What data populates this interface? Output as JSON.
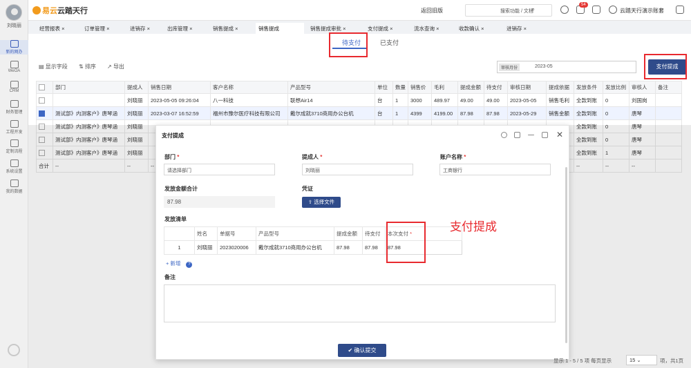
{
  "sidebar": {
    "user_name": "刘晓丽",
    "items": [
      {
        "label": "新的网办",
        "icon": "new-office-icon",
        "active": true
      },
      {
        "label": "WeOA",
        "icon": "weoa-icon",
        "active": false
      },
      {
        "label": "CRM",
        "icon": "crm-icon",
        "active": false
      },
      {
        "label": "财务管理",
        "icon": "finance-icon",
        "active": false
      },
      {
        "label": "工程开发",
        "icon": "grid-icon",
        "active": false
      },
      {
        "label": "定制流程",
        "icon": "grid-icon",
        "active": false
      },
      {
        "label": "系统设置",
        "icon": "settings-icon",
        "active": false
      },
      {
        "label": "我的数据",
        "icon": "data-icon",
        "active": false
      }
    ]
  },
  "topbar": {
    "logo_a": "易云",
    "logo_b": "云踏天行",
    "back_label": "返回旧版",
    "search_placeholder": "搜索功能 / 文档",
    "notif_count": "54",
    "user_label": "云踏天行演示账套"
  },
  "tabs": [
    "经营报表 ×",
    "订单管理 ×",
    "进销存 ×",
    "出库管理 ×",
    "销售提成 ×",
    "销售提成",
    "销售提成审批 ×",
    "支付提成 ×",
    "流水查询 ×",
    "收款确认 ×",
    "进销存 ×"
  ],
  "subtabs": {
    "pending": "待支付",
    "paid": "已支付"
  },
  "toolbar": {
    "show_fields": "显示字段",
    "sort": "排序",
    "export": "导出"
  },
  "filter": {
    "label": "审核月份",
    "value": "2023-05"
  },
  "pay_button": "支付提成",
  "table": {
    "headers": [
      "部门",
      "提成人",
      "销售日期",
      "客户名称",
      "产品型号",
      "单位",
      "数量",
      "销售价",
      "毛利",
      "提成金额",
      "待支付",
      "审核日期",
      "提成依据",
      "发放条件",
      "发放比例",
      "审核人",
      "备注"
    ],
    "rows": [
      {
        "checked": false,
        "cells": [
          "",
          "刘晓丽",
          "2023-05-05 09:26:04",
          "八一科技",
          "联想Air14",
          "台",
          "1",
          "3000",
          "489.97",
          "49.00",
          "49.00",
          "2023-05-05",
          "销售毛利",
          "全款到账",
          "0",
          "刘国岗",
          ""
        ]
      },
      {
        "checked": true,
        "cells": [
          "测试部》内测客户》唐琴涵",
          "刘晓丽",
          "2023-03-07 16:52:59",
          "福州市豫尔医疗科技有限公司",
          "戴尔成就3710商用办公台机",
          "台",
          "1",
          "4399",
          "4199.00",
          "87.98",
          "87.98",
          "2023-05-29",
          "销售金额",
          "全款到账",
          "0",
          "唐琴",
          ""
        ]
      },
      {
        "checked": false,
        "cells": [
          "测试部》内测客户》唐琴涵",
          "刘晓丽",
          "",
          "",
          "",
          "",
          "",
          "",
          "",
          "",
          "",
          "",
          "",
          "全款到账",
          "0",
          "唐琴",
          ""
        ]
      },
      {
        "checked": false,
        "cells": [
          "测试部》内测客户》唐琴涵",
          "刘晓丽",
          "",
          "",
          "",
          "",
          "",
          "",
          "",
          "",
          "",
          "",
          "",
          "全款到账",
          "0",
          "唐琴",
          ""
        ]
      },
      {
        "checked": false,
        "cells": [
          "测试部》内测客户》唐琴涵",
          "刘晓丽",
          "",
          "",
          "",
          "",
          "",
          "",
          "",
          "",
          "",
          "",
          "",
          "全款到账",
          "1",
          "唐琴",
          ""
        ]
      }
    ],
    "footer": [
      "合计",
      "--",
      "--",
      "--",
      "--",
      "--",
      "--",
      "--",
      "--",
      "--",
      "--",
      "--",
      "--",
      "--",
      "--",
      "--",
      "--"
    ]
  },
  "modal": {
    "title": "支付提成",
    "dept_label": "部门",
    "dept_placeholder": "请选择部门",
    "person_label": "提成人",
    "person_value": "刘晓丽",
    "account_label": "账户名称",
    "account_value": "工商银行",
    "total_label": "发放金额合计",
    "total_value": "87.98",
    "voucher_label": "凭证",
    "choose_file": "选择文件",
    "list_label": "发放清单",
    "list_headers": [
      "",
      "姓名",
      "单据号",
      "产品型号",
      "提成金额",
      "待支付",
      "本次支付"
    ],
    "list_rows": [
      [
        "1",
        "刘晓丽",
        "2023020006",
        "戴尔成就3710商用办公台机",
        "87.98",
        "87.98",
        "87.98"
      ]
    ],
    "add_row": "+ 新增",
    "remark_label": "备注",
    "submit": "确认提交"
  },
  "annotation": "支付提成",
  "pager": {
    "summary": "显示 1 - 5 / 5 项  每页显示",
    "per_page": "15",
    "pages": "项，共1页"
  }
}
